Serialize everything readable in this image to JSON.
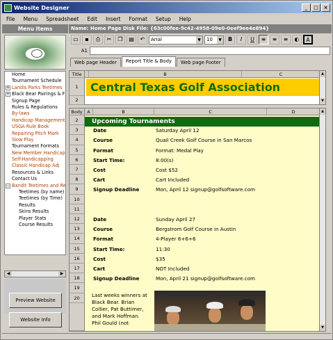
{
  "window": {
    "title": "Website Designer",
    "buttons": [
      "_",
      "□",
      "×"
    ]
  },
  "menu": [
    "File",
    "Menu",
    "Spreadsheet",
    "Edit",
    "Insert",
    "Format",
    "Setup",
    "Help"
  ],
  "sidebar": {
    "header": "Menu Items",
    "items": [
      {
        "label": "Home",
        "style": "selected"
      },
      {
        "label": "Tournament Schedule",
        "style": "normal"
      },
      {
        "label": "Landis Parks Teetimes",
        "style": "link",
        "expander": "+"
      },
      {
        "label": "Black Bear Pairings & F",
        "style": "normal",
        "expander": "+"
      },
      {
        "label": "Signup Page",
        "style": "normal"
      },
      {
        "label": "Rules & Regulations",
        "style": "normal"
      },
      {
        "label": "By-laws",
        "style": "link"
      },
      {
        "label": "Handicap Management",
        "style": "link"
      },
      {
        "label": "USGA Rule Book",
        "style": "link"
      },
      {
        "label": "Repairing Pitch Mark",
        "style": "link"
      },
      {
        "label": "Slow Play",
        "style": "link"
      },
      {
        "label": "Tournament Formats",
        "style": "normal"
      },
      {
        "label": "New Member Handicap",
        "style": "link"
      },
      {
        "label": "Self-Handicapping",
        "style": "link"
      },
      {
        "label": "Classic Handicap Adj",
        "style": "link"
      },
      {
        "label": "Resources & Links",
        "style": "normal"
      },
      {
        "label": "Contact Us",
        "style": "normal"
      },
      {
        "label": "Bandit Teetimes and Re",
        "style": "link",
        "expander": "−"
      },
      {
        "label": "Teetimes (by name)",
        "style": "sub"
      },
      {
        "label": "Teetimes (by Time)",
        "style": "sub"
      },
      {
        "label": "Results",
        "style": "sub"
      },
      {
        "label": "Skins Results",
        "style": "sub"
      },
      {
        "label": "Player Stats",
        "style": "sub"
      },
      {
        "label": "Course Results",
        "style": "sub"
      }
    ],
    "preview_button": "Preview Website",
    "info_button": "Website Info"
  },
  "namebar": "Name: Home Page   Disk File: {63c00fee-9c42-4958-09e0-0eef9ee4e894}",
  "toolbar": {
    "font": "Arial",
    "size": "10",
    "bold": "B",
    "italic": "I",
    "underline": "U"
  },
  "cellref": "A1",
  "tabs": [
    "Web page Header",
    "Report Title & Body",
    "Web page Footer"
  ],
  "title_sheet": {
    "corner": "Title",
    "cols": [
      "A",
      "B",
      "C"
    ],
    "rows": [
      "1",
      "2"
    ],
    "title": "Central Texas Golf Association"
  },
  "body_sheet": {
    "corner": "Body",
    "cols": [
      "A",
      "B",
      "C",
      "D"
    ],
    "rows": [
      "2",
      "3",
      "4",
      "5",
      "6",
      "7",
      "8",
      "9",
      "10",
      "11",
      "12",
      "13",
      "14",
      "15",
      "16",
      "17",
      "18",
      "19",
      "20"
    ],
    "heading": "Upcoming Tournaments",
    "t1": [
      [
        "Date",
        "Saturday April 12"
      ],
      [
        "Course",
        "Quail Creek Golf Course in San Marcos"
      ],
      [
        "Format",
        "Format: Medal Play"
      ],
      [
        "Start Time:",
        "8:00(s)"
      ],
      [
        "Cost",
        "Cost $52"
      ],
      [
        "Cart",
        "Cart Included"
      ],
      [
        "Signup Deadline",
        "Mon, April 12 signup@golfsoftware.com"
      ]
    ],
    "t2": [
      [
        "Date",
        "Sunday April 27"
      ],
      [
        "Course",
        "Bergstrom Golf Course in Austin"
      ],
      [
        "Format",
        "4-Player 6+6+6"
      ],
      [
        "Start Time:",
        "11:30"
      ],
      [
        "Cost",
        "$35"
      ],
      [
        "Cart",
        "NOT Included"
      ],
      [
        "Signup Deadline",
        "Mon, April 21 signup@golfsoftware.com"
      ]
    ],
    "winners": [
      "Last weeks winners at",
      "Black Bear. Brian",
      "Collier, Pat Buttimer,",
      "and Mark Hoffman.",
      "Phil Gould (not"
    ]
  }
}
